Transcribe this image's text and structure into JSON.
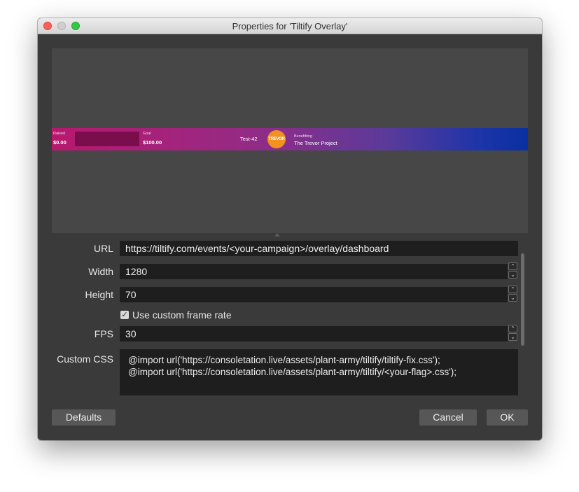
{
  "window": {
    "title": "Properties for 'Tiltify Overlay'"
  },
  "preview": {
    "raised_label": "Raised",
    "raised_value": "$0.00",
    "goal_label": "Goal",
    "goal_value": "$100.00",
    "campaign_name": "Test-42",
    "logo_text": "TREVOR",
    "benefitting_label": "Benefitting",
    "benefitting_name": "The Trevor Project"
  },
  "form": {
    "url_label": "URL",
    "url_value": "https://tiltify.com/events/<your-campaign>/overlay/dashboard",
    "width_label": "Width",
    "width_value": "1280",
    "height_label": "Height",
    "height_value": "70",
    "custom_frame_rate_label": "Use custom frame rate",
    "custom_frame_rate_checked": true,
    "fps_label": "FPS",
    "fps_value": "30",
    "custom_css_label": "Custom CSS",
    "custom_css_lines": [
      "@import url('https://consoletation.live/assets/plant-army/tiltify/tiltify-fix.css');",
      "@import url('https://consoletation.live/assets/plant-army/tiltify/<your-flag>.css');"
    ]
  },
  "buttons": {
    "defaults": "Defaults",
    "cancel": "Cancel",
    "ok": "OK"
  },
  "icons": {
    "checkmark": "✓",
    "spin_up": "⌃",
    "spin_down": "⌄"
  }
}
